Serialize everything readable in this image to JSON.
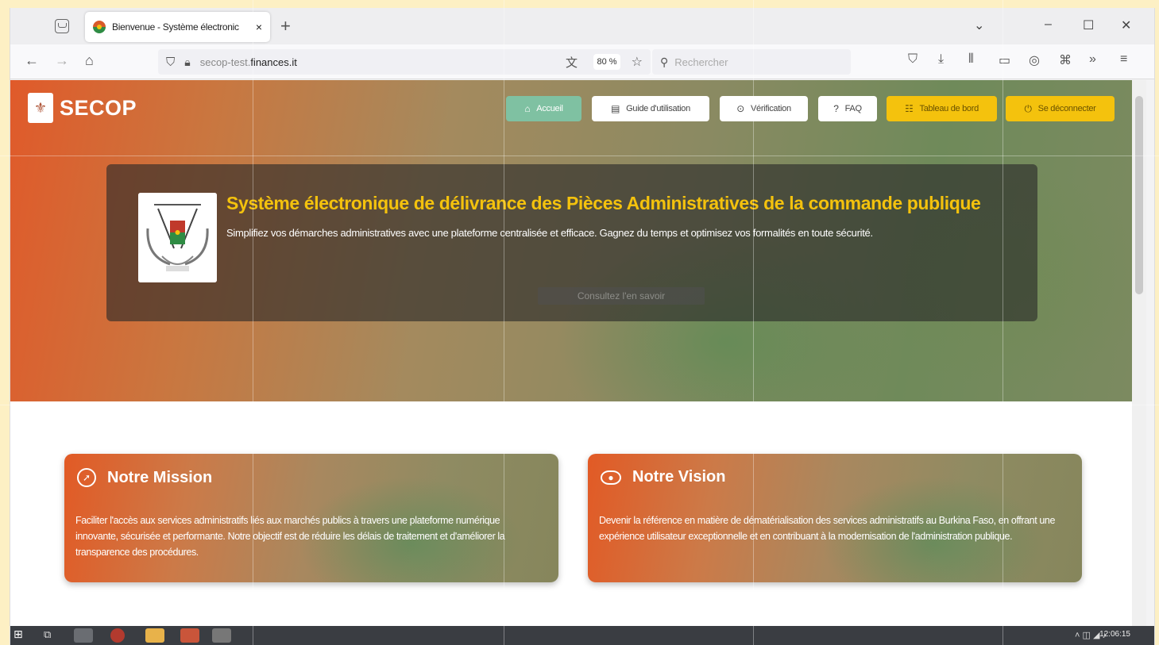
{
  "browser": {
    "tab_title": "Bienvenue - Système électronic",
    "tab_close": "×",
    "new_tab": "+",
    "url_prefix": "secop-test.",
    "url_host": "finances.it",
    "zoom": "80 %",
    "search_placeholder": "Rechercher",
    "icons": [
      "back-arrow-icon",
      "forward-arrow-icon",
      "home-icon",
      "shield-icon",
      "lock-icon",
      "translate-icon",
      "star-icon",
      "search-icon",
      "pocket-icon",
      "download-icon",
      "library-icon",
      "sidebar-icon",
      "account-icon",
      "extensions-icon",
      "overflow-icon",
      "menu-icon"
    ]
  },
  "site": {
    "logo_text": "SECOP",
    "nav": [
      {
        "label": "Accueil",
        "icon": "home-icon"
      },
      {
        "label": "Guide d'utilisation",
        "icon": "book-icon"
      },
      {
        "label": "Vérification",
        "icon": "check-icon"
      },
      {
        "label": "FAQ",
        "icon": "question-icon"
      },
      {
        "label": "Tableau de bord",
        "icon": "dashboard-icon"
      },
      {
        "label": "Se déconnecter",
        "icon": "power-icon"
      }
    ],
    "hero": {
      "title": "Système électronique de délivrance des Pièces Administratives de la commande publique",
      "subtitle": "Simplifiez vos démarches administratives avec une plateforme centralisée et efficace. Gagnez du temps et optimisez vos formalités en toute sécurité.",
      "button": "Consultez l'en savoir"
    },
    "cards": [
      {
        "title": "Notre Mission",
        "icon": "compass-icon",
        "text": "Faciliter l'accès aux services administratifs liés aux marchés publics à travers une plateforme numérique innovante, sécurisée et performante. Notre objectif est de réduire les délais de traitement et d'améliorer la transparence des procédures."
      },
      {
        "title": "Notre Vision",
        "icon": "eye-icon",
        "text": "Devenir la référence en matière de dématérialisation des services administratifs au Burkina Faso, en offrant une expérience utilisateur exceptionnelle et en contribuant à la modernisation de l'administration publique."
      }
    ]
  },
  "taskbar": {
    "clock": "12:06:15"
  },
  "colors": {
    "accent_yellow": "#f4c20d",
    "active_green": "#7fc1a2",
    "hero_orange": "#e05a2a",
    "hero_green": "#6f8a5a"
  }
}
